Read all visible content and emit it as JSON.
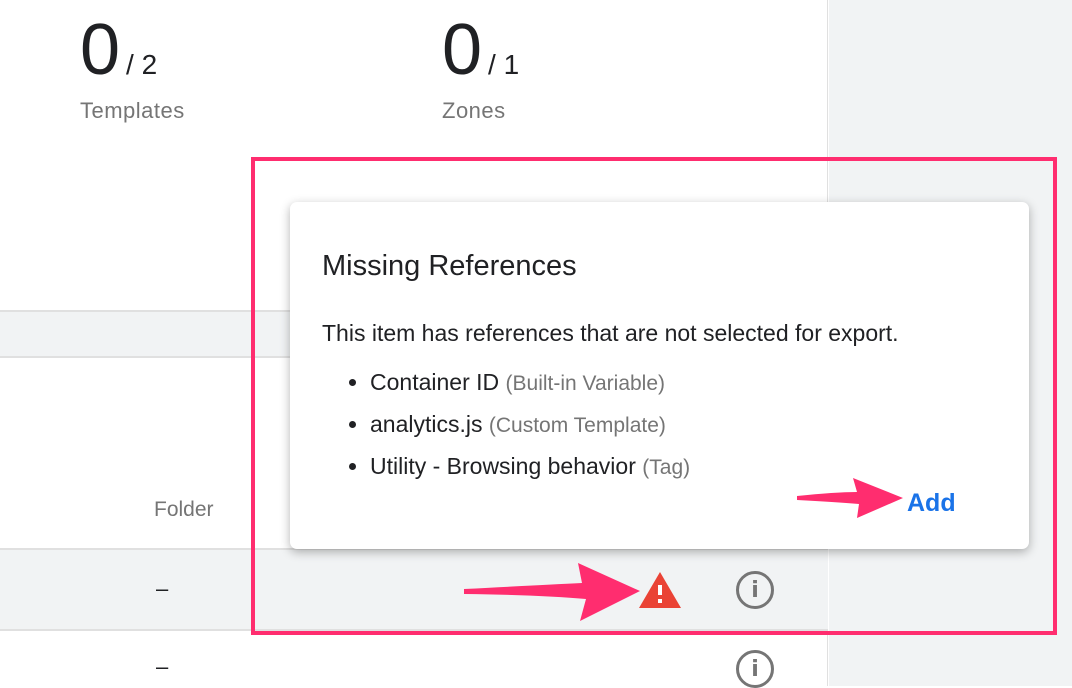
{
  "stats": [
    {
      "count": "0",
      "total": "/ 2",
      "label": "Templates"
    },
    {
      "count": "0",
      "total": "/ 1",
      "label": "Zones"
    }
  ],
  "table": {
    "folder_header": "Folder",
    "rows": [
      {
        "folder": "–",
        "warning": true
      },
      {
        "folder": "–",
        "warning": false
      }
    ]
  },
  "popup": {
    "title": "Missing References",
    "message": "This item has references that are not selected for export.",
    "items": [
      {
        "name": "Container ID",
        "type": "(Built-in Variable)"
      },
      {
        "name": "analytics.js",
        "type": "(Custom Template)"
      },
      {
        "name": "Utility - Browsing behavior",
        "type": "(Tag)"
      }
    ],
    "add_label": "Add"
  },
  "colors": {
    "highlight": "#ff2d6f",
    "warning": "#ea4335",
    "link": "#1a73e8"
  }
}
